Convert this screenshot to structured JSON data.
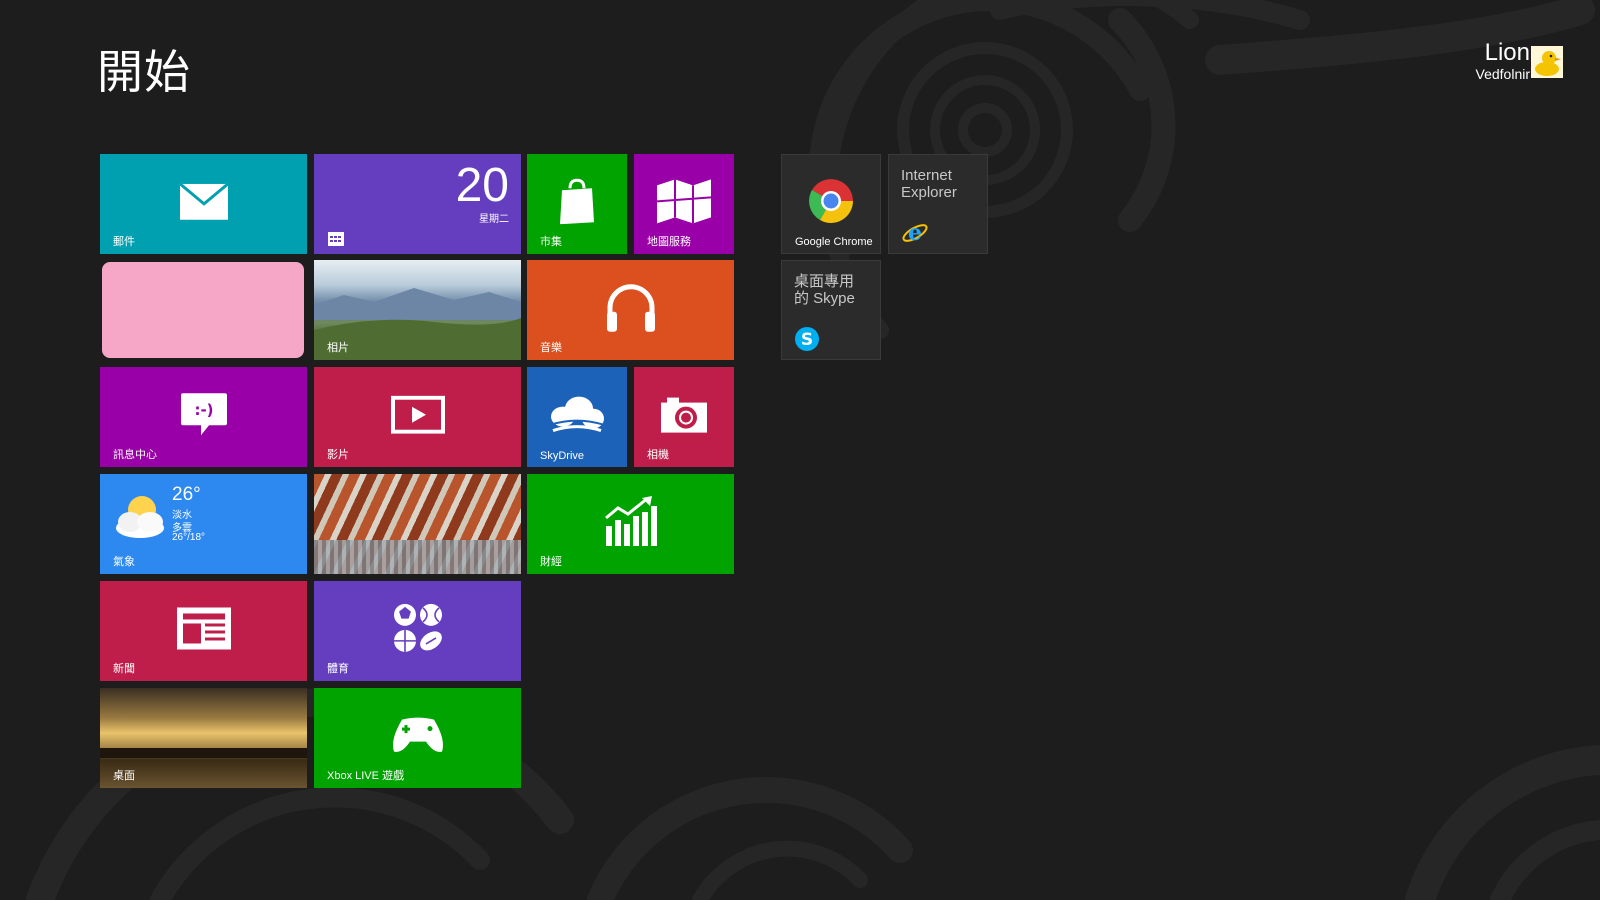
{
  "start": {
    "title": "開始"
  },
  "user": {
    "name": "Lion",
    "subtitle": "Vedfolnir"
  },
  "tiles": {
    "mail": {
      "label": "郵件"
    },
    "calendar": {
      "day": "20",
      "weekday": "星期二"
    },
    "store": {
      "label": "市集"
    },
    "maps": {
      "label": "地圖服務"
    },
    "photos": {
      "label": "相片"
    },
    "music": {
      "label": "音樂"
    },
    "messaging": {
      "label": "訊息中心"
    },
    "video": {
      "label": "影片"
    },
    "skydrive": {
      "label": "SkyDrive"
    },
    "camera": {
      "label": "相機"
    },
    "weather": {
      "label": "氣象",
      "temp": "26°",
      "city": "淡水",
      "condition": "多雲",
      "range": "26°/18°"
    },
    "finance": {
      "label": "財經"
    },
    "news": {
      "label": "新聞"
    },
    "sports": {
      "label": "體育"
    },
    "desktop": {
      "label": "桌面"
    },
    "xbox": {
      "label": "Xbox LIVE 遊戲"
    },
    "chrome": {
      "label": "Google Chrome"
    },
    "ie": {
      "title": "Internet\nExplorer"
    },
    "skype": {
      "title": "桌面專用\n的 Skype"
    }
  },
  "colors": {
    "background": "#1d1d1d",
    "teal": "#00a0b1",
    "purple": "#643ebf",
    "green": "#00a300",
    "magenta": "#9900a8",
    "orange": "#dc4f1e",
    "crimson": "#bf1e4b",
    "blue": "#2d89ef",
    "skydrive": "#1c62b9"
  }
}
